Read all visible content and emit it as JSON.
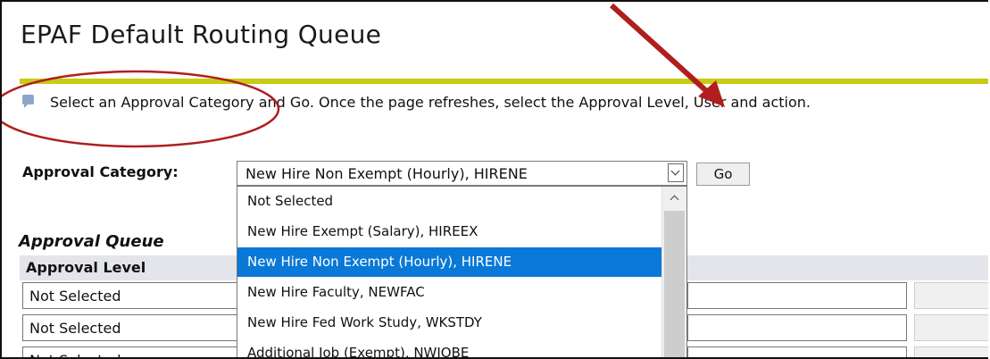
{
  "page": {
    "title": "EPAF Default Routing Queue",
    "instruction": "Select an Approval Category and Go. Once the page refreshes, select the Approval Level, User and action."
  },
  "form": {
    "category_label": "Approval Category:",
    "category_selected": "New Hire Non Exempt (Hourly), HIRENE",
    "go_label": "Go"
  },
  "dropdown": {
    "options": [
      "Not Selected",
      "New Hire Exempt (Salary), HIREEX",
      "New Hire Non Exempt (Hourly), HIRENE",
      "New Hire Faculty, NEWFAC",
      "New Hire Fed Work Study, WKSTDY",
      "Additional Job (Exempt), NWJOBE"
    ],
    "highlighted": "New Hire Non Exempt (Hourly), HIRENE"
  },
  "queue": {
    "section_title": "Approval Queue",
    "header_level": "Approval Level",
    "rows": [
      "Not Selected",
      "Not Selected",
      "Not Selected"
    ]
  },
  "colors": {
    "accent_rule": "#c8cb12",
    "highlight": "#0a78d7",
    "annotation": "#b01e1e"
  },
  "icons": {
    "info": "info-icon",
    "dropdown_arrow": "chevron-down-icon",
    "scroll_up": "chevron-up-icon",
    "annotation_arrow": "arrow-icon"
  }
}
